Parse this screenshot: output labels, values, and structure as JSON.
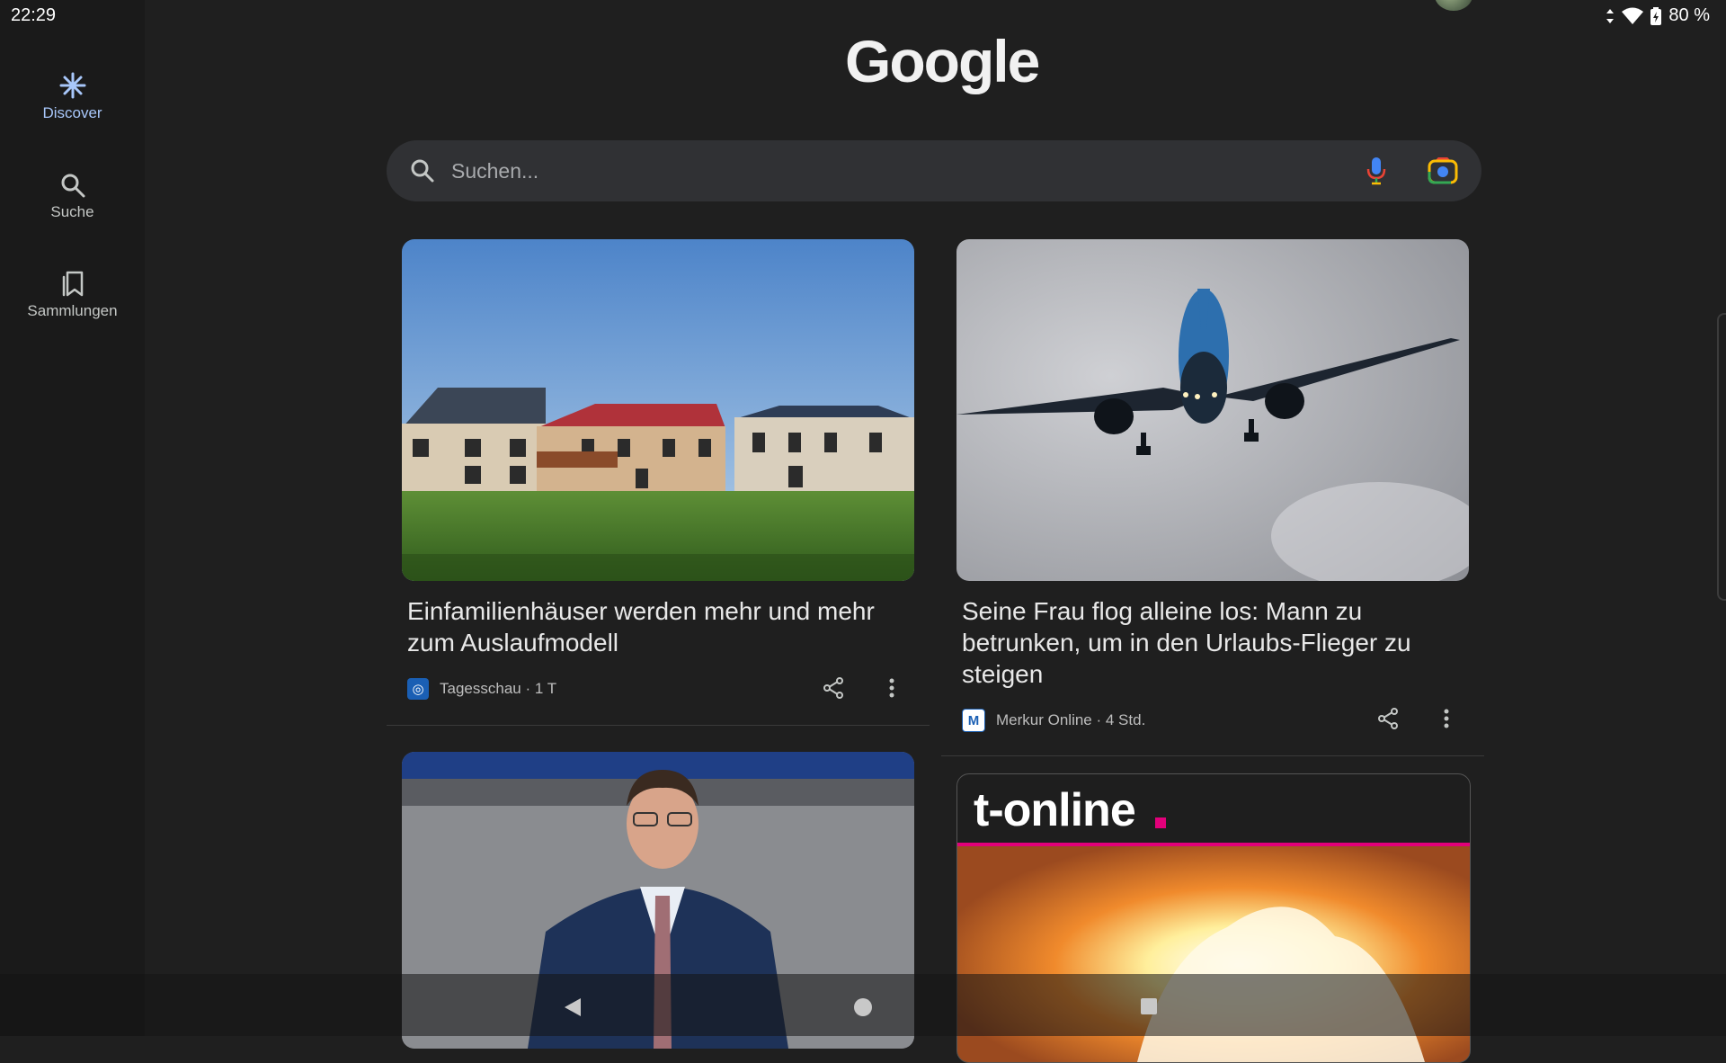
{
  "status_bar": {
    "time": "22:29",
    "battery": "80 %",
    "icons": [
      "data-arrows-icon",
      "wifi-icon",
      "battery-icon"
    ]
  },
  "nav_rail": {
    "items": [
      {
        "label": "Discover",
        "icon": "discover-sparkle-icon",
        "active": true
      },
      {
        "label": "Suche",
        "icon": "search-icon",
        "active": false
      },
      {
        "label": "Sammlungen",
        "icon": "bookmarks-icon",
        "active": false
      }
    ]
  },
  "header": {
    "logo": "Google"
  },
  "search": {
    "placeholder": "Suchen..."
  },
  "feed": [
    {
      "title": "Einfamilienhäuser werden mehr und mehr zum Auslaufmodell",
      "source": "Tagesschau",
      "age": "1 T",
      "image": "houses-field-photo"
    },
    {
      "title": "Seine Frau flog alleine los: Mann zu betrunken, um in den Urlaubs-Flieger zu steigen",
      "source": "Merkur Online",
      "age": "4 Std.",
      "image": "airplane-photo"
    },
    {
      "title": "",
      "image": "politician-bundestag-photo"
    },
    {
      "brand": "t-online",
      "image": "explosion-photo"
    }
  ],
  "meta_separator": " · ",
  "colors": {
    "background": "#1f1f1f",
    "rail": "#1a1a1a",
    "accent": "#a8c7fa",
    "search": "#303134",
    "t_online_dot": "#e2007a"
  }
}
